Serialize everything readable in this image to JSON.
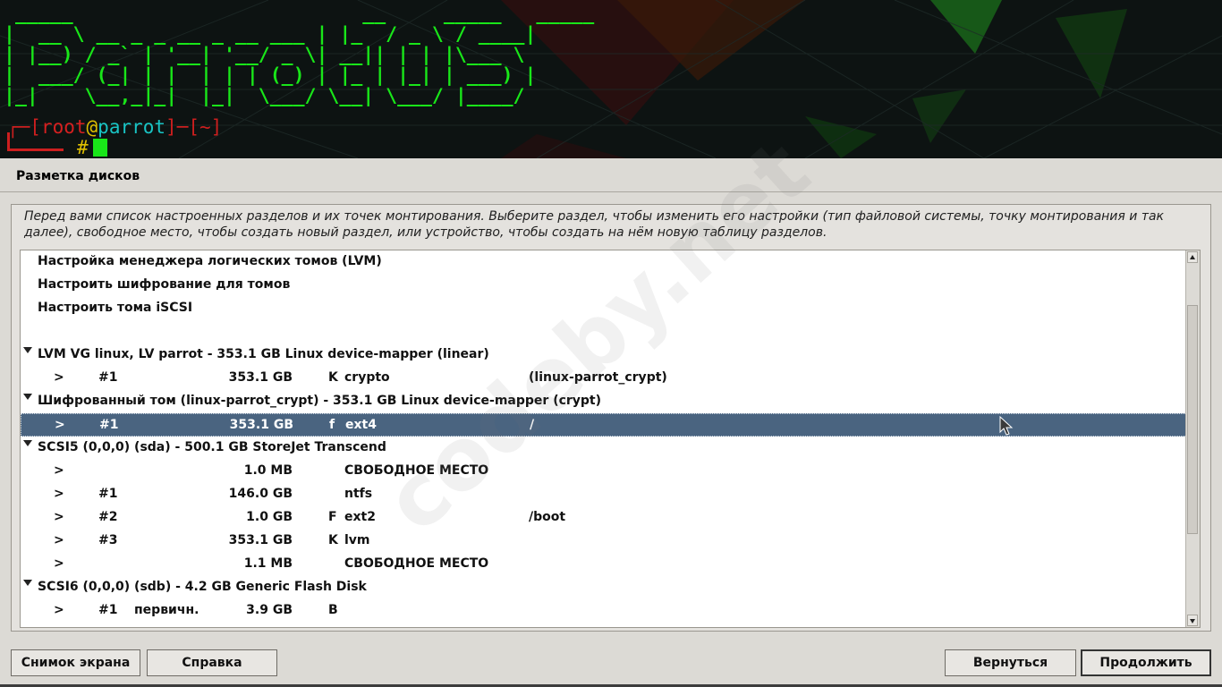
{
  "banner": {
    "logo_lines": [
      " _____                         __     _____   _____ ",
      "|  __ \\ __ _ _ __ _ __ ___ | |_  / _ \\ / ____|",
      "| |__) / _` | '__| '__/ _ \\| __|| | | |\\___ \\ ",
      "|  ___/ (_| | |  | | | (_) | |_ | |_| | ___) |",
      "|_|    \\__,_|_|  |_|  \\___/ \\__| \\___/ |____/ "
    ],
    "prompt_open": "┌─[",
    "prompt_user": "root",
    "prompt_at": "@",
    "prompt_host": "parrot",
    "prompt_close": "]─[~]",
    "prompt_hash": "#"
  },
  "page_title": "Разметка дисков",
  "description": "Перед вами список настроенных разделов и их точек монтирования. Выберите раздел, чтобы изменить его настройки (тип файловой системы, точку монтирования и так далее), свободное место, чтобы создать новый раздел, или устройство, чтобы создать на нём новую таблицу разделов.",
  "watermark": "codeby.net",
  "rows": [
    {
      "head": "Настройка менеджера логических томов (LVM)"
    },
    {
      "head": "Настроить шифрование для томов"
    },
    {
      "head": "Настроить тома iSCSI"
    },
    {
      "head": ""
    },
    {
      "head": "LVM VG linux, LV parrot - 353.1 GB Linux device-mapper (linear)",
      "expanded": true
    },
    {
      "arrow": ">",
      "num": "#1",
      "type": "",
      "size": "353.1 GB",
      "flag": "K",
      "fs": "crypto",
      "mount": "(linux-parrot_crypt)"
    },
    {
      "head": "Шифрованный том (linux-parrot_crypt) - 353.1 GB Linux device-mapper (crypt)",
      "expanded": true
    },
    {
      "arrow": ">",
      "num": "#1",
      "type": "",
      "size": "353.1 GB",
      "flag": "f",
      "fs": "ext4",
      "mount": "/",
      "selected": true
    },
    {
      "head": "SCSI5 (0,0,0) (sda) - 500.1 GB StoreJet Transcend",
      "expanded": true
    },
    {
      "arrow": ">",
      "num": "",
      "type": "",
      "size": "1.0 MB",
      "flag": "",
      "fs": "СВОБОДНОЕ МЕСТО",
      "mount": ""
    },
    {
      "arrow": ">",
      "num": "#1",
      "type": "",
      "size": "146.0 GB",
      "flag": "",
      "fs": "ntfs",
      "mount": ""
    },
    {
      "arrow": ">",
      "num": "#2",
      "type": "",
      "size": "1.0 GB",
      "flag": "F",
      "fs": "ext2",
      "mount": "/boot"
    },
    {
      "arrow": ">",
      "num": "#3",
      "type": "",
      "size": "353.1 GB",
      "flag": "K",
      "fs": "lvm",
      "mount": ""
    },
    {
      "arrow": ">",
      "num": "",
      "type": "",
      "size": "1.1 MB",
      "flag": "",
      "fs": "СВОБОДНОЕ МЕСТО",
      "mount": ""
    },
    {
      "head": "SCSI6 (0,0,0) (sdb) - 4.2 GB Generic Flash Disk",
      "expanded": true
    },
    {
      "arrow": ">",
      "num": "#1",
      "type": "первичн.",
      "size": "3.9 GB",
      "flag": "B",
      "fs": "",
      "mount": ""
    }
  ],
  "scrollbar": {
    "position_fraction": 0.12,
    "visible_fraction": 0.65
  },
  "buttons": {
    "screenshot": "Снимок экрана",
    "help": "Справка",
    "back": "Вернуться",
    "continue": "Продолжить"
  },
  "colors": {
    "selection": "#4a6480",
    "terminal_green": "#19e619",
    "terminal_bg": "#0d1312",
    "window_bg": "#dcdad5"
  }
}
